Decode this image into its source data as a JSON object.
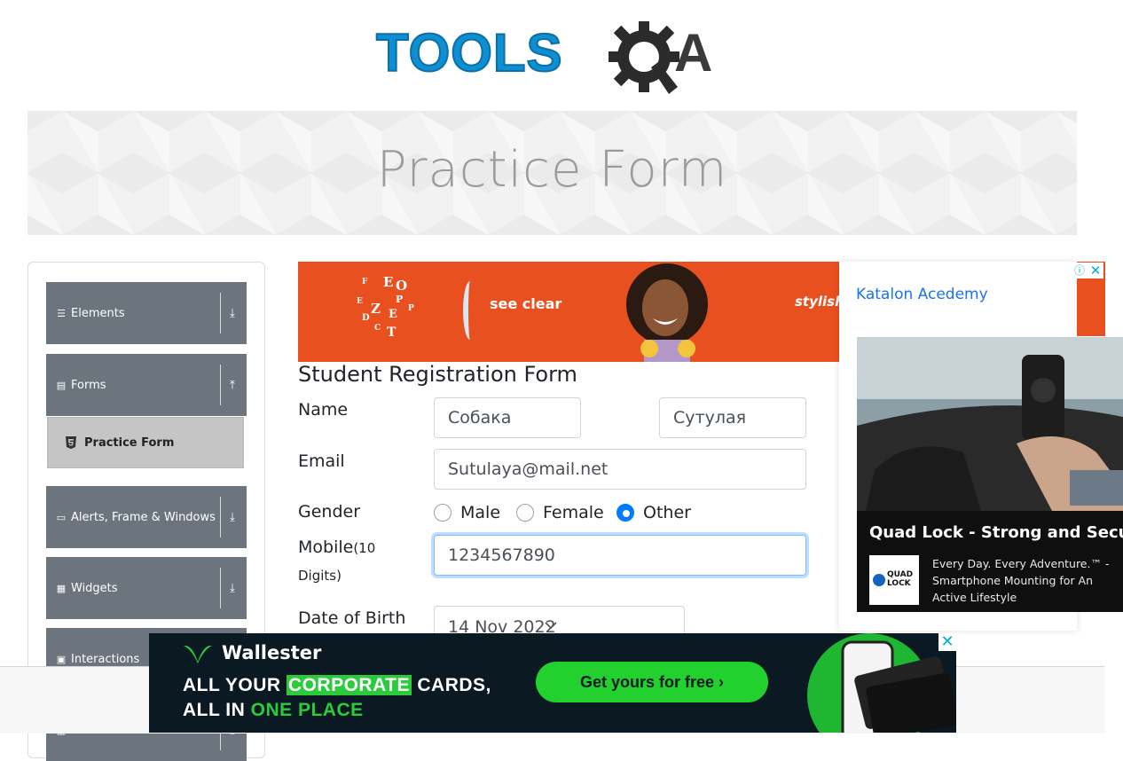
{
  "header": {
    "logo_text": "TOOLS",
    "logo_suffix": "A"
  },
  "banner": {
    "title": "Practice Form"
  },
  "sidebar": {
    "groups": [
      {
        "label": "Elements",
        "arrow": "⤓"
      },
      {
        "label": "Forms",
        "arrow": "⤒"
      },
      {
        "label": "Alerts, Frame & Windows",
        "arrow": "⤓"
      },
      {
        "label": "Widgets",
        "arrow": "⤓"
      },
      {
        "label": "Interactions",
        "arrow": "⤓"
      },
      {
        "label": "",
        "arrow": "⤓"
      }
    ],
    "active_item": "Practice Form"
  },
  "top_ad": {
    "tagline": "see clear",
    "tag2": "stylish",
    "letters": [
      "F",
      "E",
      "O",
      "P",
      "Z",
      "E",
      "D",
      "P",
      "T",
      "C",
      "E"
    ]
  },
  "form": {
    "title": "Student Registration Form",
    "name_label": "Name",
    "first_name": "Собака",
    "last_name": "Сутулая",
    "email_label": "Email",
    "email": "Sutulaya@mail.net",
    "gender_label": "Gender",
    "genders": [
      "Male",
      "Female",
      "Other"
    ],
    "gender_selected": "Other",
    "mobile_label": "Mobile",
    "mobile_hint_a": "(10",
    "mobile_hint_b": "Digits)",
    "mobile": "1234567890",
    "dob_label": "Date of Birth",
    "dob": "14 Nov 2022"
  },
  "right_ad": {
    "link": "Katalon Acedemy",
    "info_icon": "info-icon",
    "close_icon": "close-icon",
    "quadlock_title": "Quad Lock - Strong and Secure",
    "quadlock_logo": "QUAD LOCK",
    "quadlock_desc": "Every Day. Every Adventure.™ - Smartphone Mounting for An Active Lifestyle"
  },
  "bottom_ad": {
    "brand": "Wallester",
    "line1_a": "ALL YOUR ",
    "line1_hl": "CORPORATE",
    "line1_b": " CARDS,",
    "line2_a": "ALL IN ",
    "line2_hl": "ONE PLACE",
    "cta": "Get yours for free ›",
    "close": "✕"
  },
  "colors": {
    "sidebar_header": "#6c757d",
    "active_item": "#c5c5c5",
    "primary": "#007bff",
    "ad_orange": "#e8501f",
    "wallester_green": "#22d12e"
  }
}
